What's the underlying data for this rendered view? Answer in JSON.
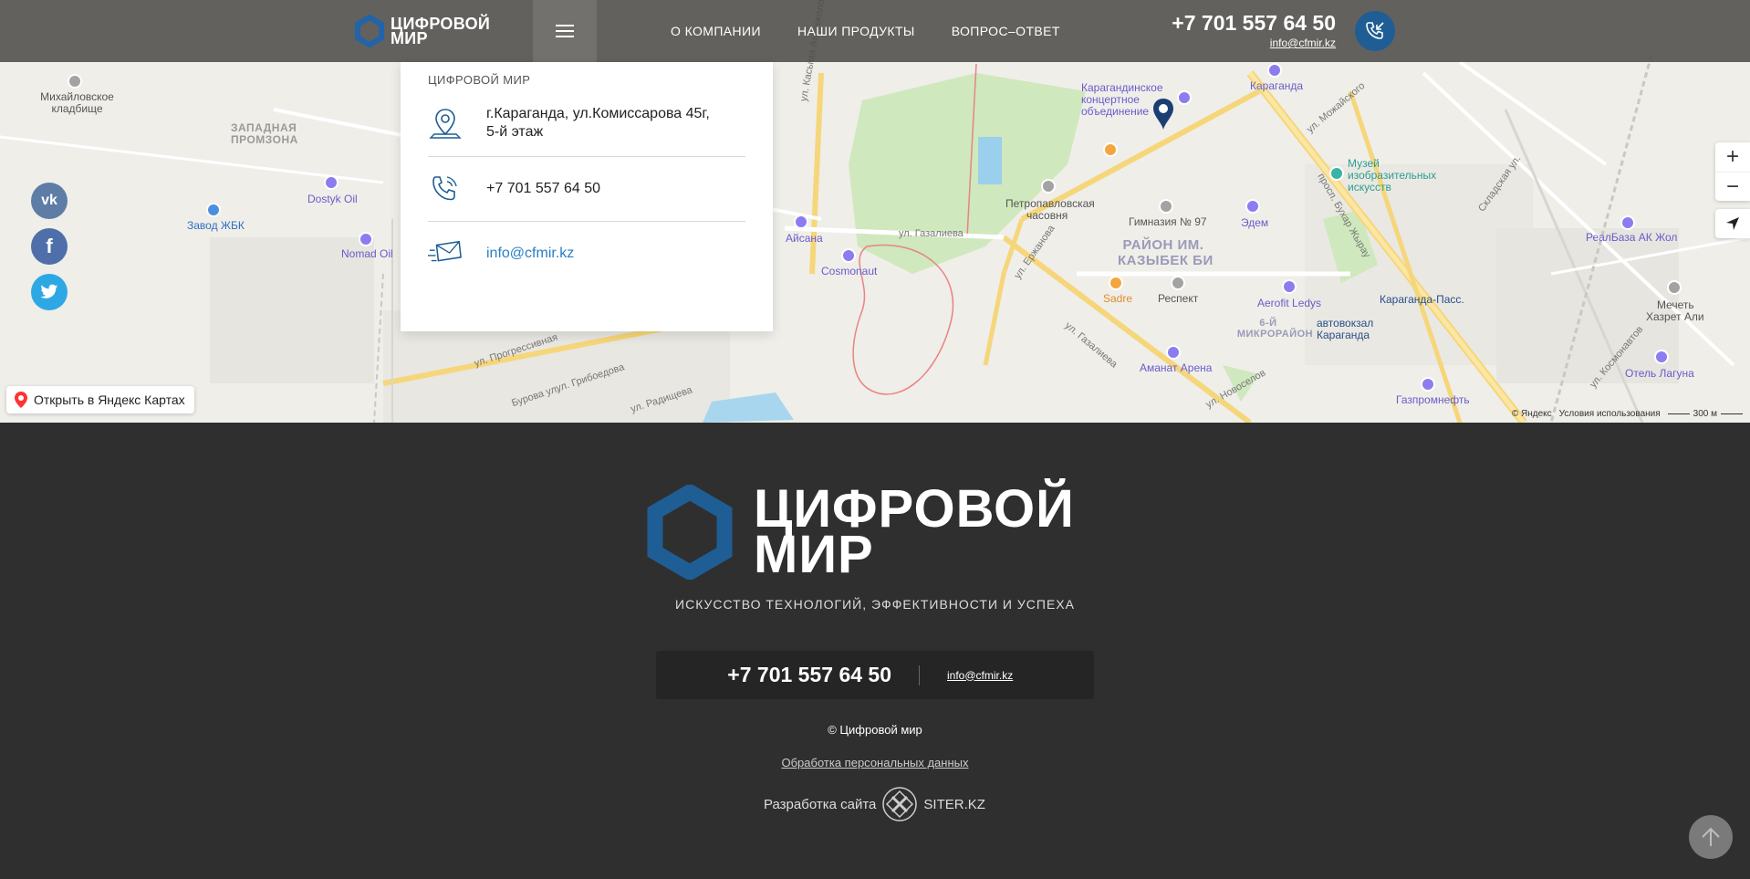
{
  "header": {
    "logo_line1": "ЦИФРОВОЙ",
    "logo_line2": "МИР",
    "nav": [
      {
        "label": "О КОМПАНИИ"
      },
      {
        "label": "НАШИ ПРОДУКТЫ"
      },
      {
        "label": "ВОПРОС–ОТВЕТ"
      }
    ],
    "phone": "+7 701 557 64 50",
    "email": "info@cfmir.kz"
  },
  "card": {
    "title": "ЦИФРОВОЙ МИР",
    "address_line1": "г.Караганда, ул.Комиссарова 45г,",
    "address_line2": "5-й этаж",
    "phone": "+7 701 557 64 50",
    "email": "info@cfmir.kz"
  },
  "social": [
    {
      "name": "vk",
      "glyph": "vk"
    },
    {
      "name": "facebook",
      "glyph": "f"
    },
    {
      "name": "twitter",
      "glyph": "t"
    }
  ],
  "map": {
    "open_in_yandex": "Открыть в Яндекс Картах",
    "copyright": "© Яндекс",
    "terms": "Условия использования",
    "scale": "300 м",
    "zoom_in": "+",
    "zoom_out": "−",
    "labels": {
      "mikh": "Михайловское кладбище",
      "zapadnaya_1": "ЗАПАДНАЯ",
      "zapadnaya_2": "ПРОМЗОНА",
      "dostyk": "Dostyk Oil",
      "zavod": "Завод ЖБК",
      "nomad": "Nomad Oil",
      "aisana": "Айсана",
      "cosmonaut": "Cosmonaut",
      "gazalieva1": "ул. Газалиева",
      "gazalieva2": "ул. Газалиева",
      "erzhanova": "ул. Ержанова",
      "kasym": "ул. Касыма Аманжолова",
      "konc_1": "Карагандинское",
      "konc_2": "концертное",
      "konc_3": "объединение",
      "karaganda": "Караганда",
      "chasovnya_1": "Петропавловская",
      "chasovnya_2": "часовня",
      "gymn": "Гимназия № 97",
      "district_1": "РАЙОН ИМ.",
      "district_2": "КАЗЫБЕК БИ",
      "edem": "Эдем",
      "sadre": "Sadre",
      "respect": "Респект",
      "aerofit": "Aerofit Ledys",
      "mikro_1": "6-Й",
      "mikro_2": "МИКРОРАЙОН",
      "avtovokzal_1": "автовокзал",
      "avtovokzal_2": "Караганда",
      "karaganda_pass": "Караганда-Пасс.",
      "amanat": "Аманат Арена",
      "muzey_1": "Музей",
      "muzey_2": "изобразительных",
      "muzey_3": "искусств",
      "bukhar": "просп. Бухар Жырау",
      "realbaza": "РеалБаза АК Жол",
      "mechet_1": "Мечеть",
      "mechet_2": "Хазрет Али",
      "otel": "Отель Лагуна",
      "gazprom": "Газпромнефть",
      "novoselov": "ул. Новоселов",
      "progress": "ул. Прогрессивная",
      "griboedova": "ул. Грибоедова",
      "radischeva": "ул. Радищева",
      "burova": "Бурова ул.",
      "mozhayskogo": "ул. Можайского",
      "skladskaya": "Складская ул.",
      "kosmonavtov": "ул. Космонавтов"
    }
  },
  "footer": {
    "logo_line1": "ЦИФРОВОЙ",
    "logo_line2": "МИР",
    "slogan": "ИСКУССТВО ТЕХНОЛОГИЙ, ЭФФЕКТИВНОСТИ И УСПЕХА",
    "phone": "+7 701 557 64 50",
    "email": "info@cfmir.kz",
    "copyright": "© Цифровой мир",
    "privacy": "Обработка персональных данных",
    "dev_label": "Разработка сайта",
    "dev_company": "SITER.KZ"
  },
  "colors": {
    "brand_blue": "#1f5d95",
    "header_bg": "#4e4d4a",
    "footer_bg": "#2f2f2f",
    "link_blue": "#2a7fc4"
  }
}
